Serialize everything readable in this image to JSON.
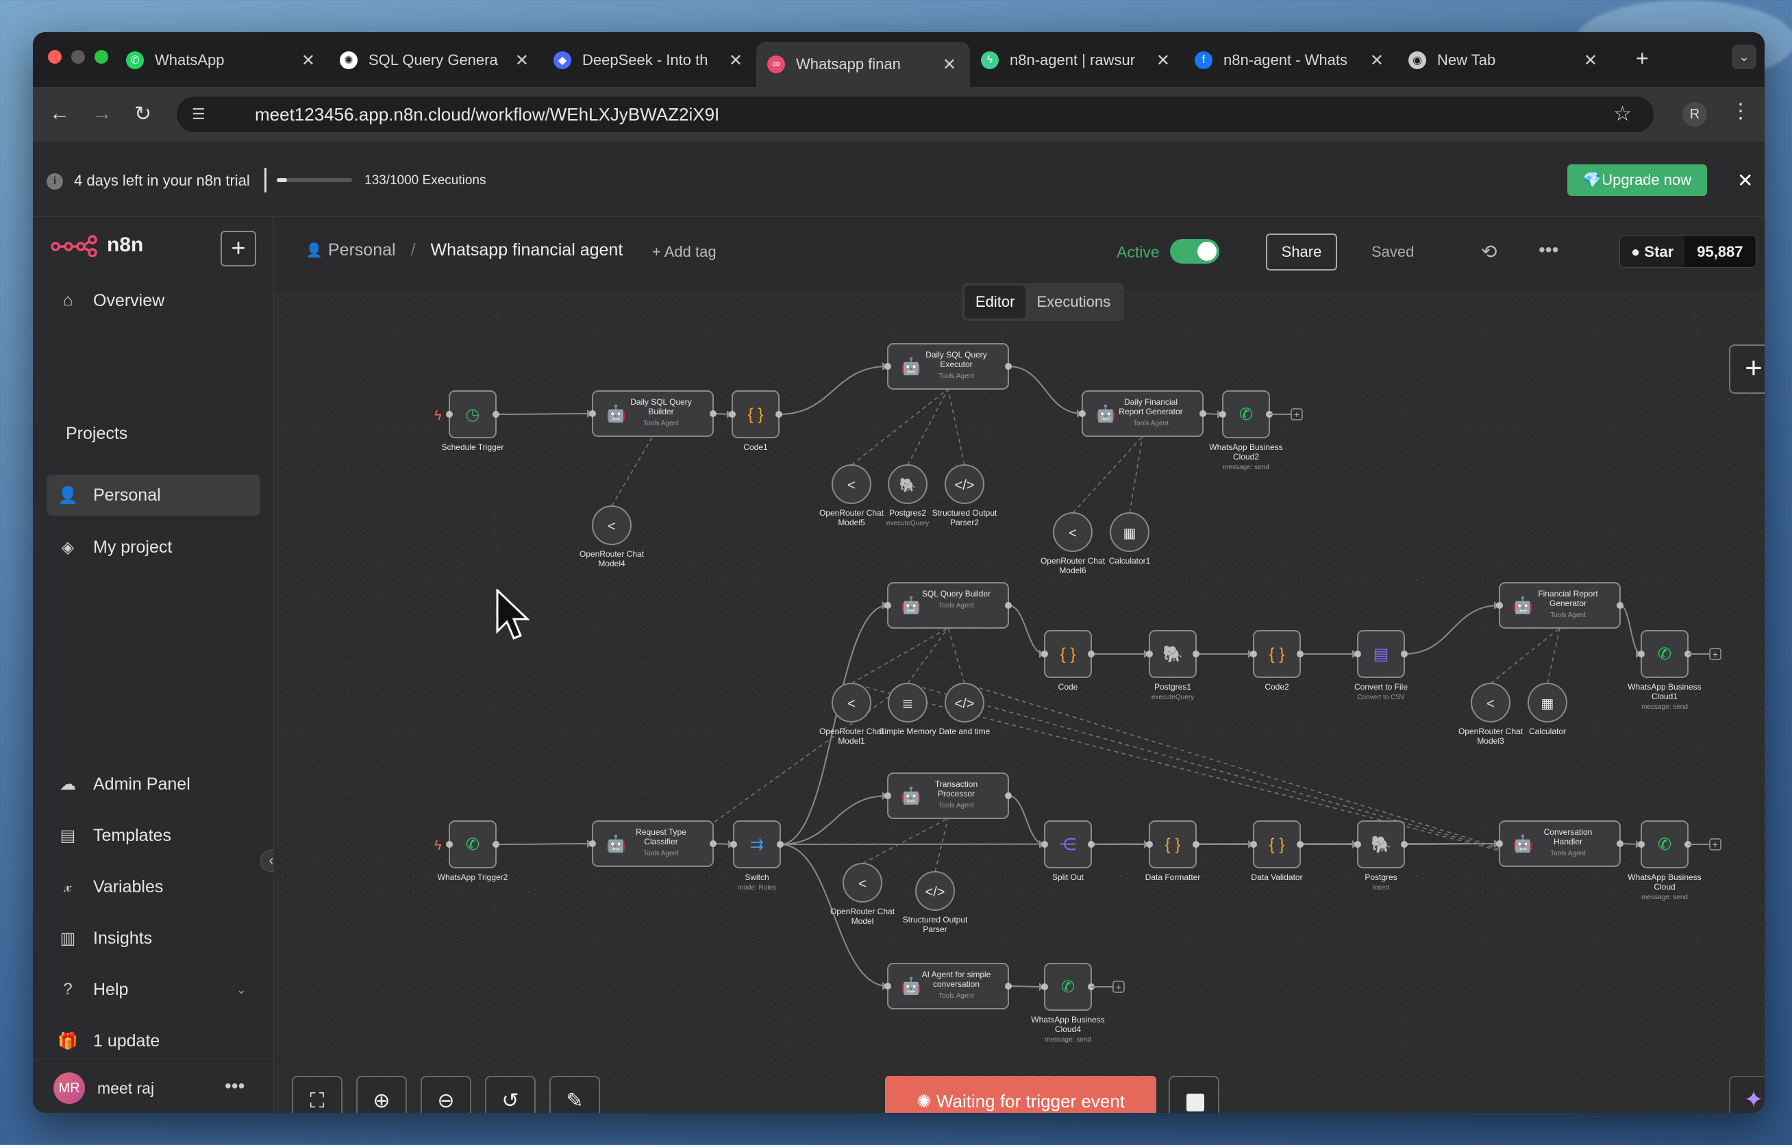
{
  "browser": {
    "tabs": [
      {
        "label": "WhatsApp",
        "icon": "whatsapp-icon",
        "color": "#25d366"
      },
      {
        "label": "SQL Query Genera",
        "icon": "openai-icon",
        "color": "#ffffff"
      },
      {
        "label": "DeepSeek - Into th",
        "icon": "deepseek-icon",
        "color": "#4d6bfe"
      },
      {
        "label": "Whatsapp finan",
        "icon": "n8n-icon",
        "color": "#ea4b71"
      },
      {
        "label": "n8n-agent | rawsur",
        "icon": "bolt-icon",
        "color": "#3fcf8e"
      },
      {
        "label": "n8n-agent - Whats",
        "icon": "facebook-icon",
        "color": "#1877f2"
      },
      {
        "label": "New Tab",
        "icon": "chrome-icon",
        "color": "#cccccc"
      }
    ],
    "url": "meet123456.app.n8n.cloud/workflow/WEhLXJyBWAZ2iX9I",
    "profile_initial": "R"
  },
  "trial": {
    "message": "4 days left in your n8n trial",
    "executions": "133/1000 Executions",
    "executions_used_fraction": 0.133,
    "upgrade_label": "Upgrade now"
  },
  "sidebar": {
    "brand": "n8n",
    "overview": "Overview",
    "projects_heading": "Projects",
    "projects": [
      "Personal",
      "My project"
    ],
    "bottom_items": [
      "Admin Panel",
      "Templates",
      "Variables",
      "Insights",
      "Help",
      "1 update"
    ],
    "user": {
      "initials": "MR",
      "name": "meet raj"
    }
  },
  "header": {
    "project": "Personal",
    "workflow_name": "Whatsapp financial agent",
    "add_tag": "+ Add tag",
    "active_label": "Active",
    "share_label": "Share",
    "saved_label": "Saved",
    "star_label": "Star",
    "star_count": "95,887"
  },
  "canvas": {
    "tabs": [
      "Editor",
      "Executions"
    ],
    "waiting_label": "Waiting for trigger event",
    "nodes": [
      {
        "id": "sched",
        "title": [
          "Schedule Trigger"
        ],
        "sub": "",
        "icon": "clock-icon"
      },
      {
        "id": "dsqlb",
        "title": [
          "Daily SQL Query",
          "Builder"
        ],
        "sub": "Tools Agent",
        "icon": "robot-icon"
      },
      {
        "id": "code1",
        "title": [
          "Code1"
        ],
        "sub": "",
        "icon": "code-braces-icon"
      },
      {
        "id": "dsqle",
        "title": [
          "Daily SQL Query",
          "Executor"
        ],
        "sub": "Tools Agent",
        "icon": "robot-icon"
      },
      {
        "id": "dfrg",
        "title": [
          "Daily Financial",
          "Report Generator"
        ],
        "sub": "Tools Agent",
        "icon": "robot-icon"
      },
      {
        "id": "wab2",
        "title": [
          "WhatsApp Business",
          "Cloud2"
        ],
        "sub": "message: send",
        "icon": "whatsapp-icon"
      },
      {
        "id": "orm4",
        "title": [
          "OpenRouter Chat",
          "Model4"
        ],
        "sub": "",
        "icon": "openrouter-icon"
      },
      {
        "id": "orm5",
        "title": [
          "OpenRouter Chat",
          "Model5"
        ],
        "sub": "",
        "icon": "openrouter-icon"
      },
      {
        "id": "pg2",
        "title": [
          "Postgres2"
        ],
        "sub": "executeQuery",
        "icon": "postgres-icon"
      },
      {
        "id": "sop2",
        "title": [
          "Structured Output",
          "Parser2"
        ],
        "sub": "",
        "icon": "code-tag-icon"
      },
      {
        "id": "orm6",
        "title": [
          "OpenRouter Chat",
          "Model6"
        ],
        "sub": "",
        "icon": "openrouter-icon"
      },
      {
        "id": "calc1",
        "title": [
          "Calculator1"
        ],
        "sub": "",
        "icon": "calculator-icon"
      },
      {
        "id": "sqlb",
        "title": [
          "SQL Query Builder"
        ],
        "sub": "Tools Agent",
        "icon": "robot-icon"
      },
      {
        "id": "code",
        "title": [
          "Code"
        ],
        "sub": "",
        "icon": "code-braces-icon"
      },
      {
        "id": "pg1",
        "title": [
          "Postgres1"
        ],
        "sub": "executeQuery",
        "icon": "postgres-icon"
      },
      {
        "id": "code2",
        "title": [
          "Code2"
        ],
        "sub": "",
        "icon": "code-braces-icon"
      },
      {
        "id": "ctf",
        "title": [
          "Convert to File"
        ],
        "sub": "Convert to CSV",
        "icon": "file-icon"
      },
      {
        "id": "frg",
        "title": [
          "Financial Report",
          "Generator"
        ],
        "sub": "Tools Agent",
        "icon": "robot-icon"
      },
      {
        "id": "wab1",
        "title": [
          "WhatsApp Business",
          "Cloud1"
        ],
        "sub": "message: send",
        "icon": "whatsapp-icon"
      },
      {
        "id": "orm1",
        "title": [
          "OpenRouter Chat",
          "Model1"
        ],
        "sub": "",
        "icon": "openrouter-icon"
      },
      {
        "id": "simem",
        "title": [
          "Simple Memory"
        ],
        "sub": "",
        "icon": "database-icon"
      },
      {
        "id": "dt",
        "title": [
          "Date and time"
        ],
        "sub": "",
        "icon": "code-tag-icon"
      },
      {
        "id": "orm3",
        "title": [
          "OpenRouter Chat",
          "Model3"
        ],
        "sub": "",
        "icon": "openrouter-icon"
      },
      {
        "id": "calc",
        "title": [
          "Calculator"
        ],
        "sub": "",
        "icon": "calculator-icon"
      },
      {
        "id": "wat2",
        "title": [
          "WhatsApp Trigger2"
        ],
        "sub": "",
        "icon": "whatsapp-icon"
      },
      {
        "id": "rtc",
        "title": [
          "Request Type",
          "Classifier"
        ],
        "sub": "Tools Agent",
        "icon": "robot-icon"
      },
      {
        "id": "switch",
        "title": [
          "Switch"
        ],
        "sub": "mode: Rules",
        "icon": "switch-icon"
      },
      {
        "id": "tp",
        "title": [
          "Transaction",
          "Processor"
        ],
        "sub": "Tools Agent",
        "icon": "robot-icon"
      },
      {
        "id": "split",
        "title": [
          "Split Out"
        ],
        "sub": "",
        "icon": "split-icon"
      },
      {
        "id": "df",
        "title": [
          "Data Formatter"
        ],
        "sub": "",
        "icon": "code-braces-icon"
      },
      {
        "id": "dv",
        "title": [
          "Data Validator"
        ],
        "sub": "",
        "icon": "code-braces-icon"
      },
      {
        "id": "pg",
        "title": [
          "Postgres"
        ],
        "sub": "insert",
        "icon": "postgres-icon"
      },
      {
        "id": "ch",
        "title": [
          "Conversation",
          "Handler"
        ],
        "sub": "Tools Agent",
        "icon": "robot-icon"
      },
      {
        "id": "wab",
        "title": [
          "WhatsApp Business",
          "Cloud"
        ],
        "sub": "message: send",
        "icon": "whatsapp-icon"
      },
      {
        "id": "orm",
        "title": [
          "OpenRouter Chat",
          "Model"
        ],
        "sub": "",
        "icon": "openrouter-icon"
      },
      {
        "id": "sop",
        "title": [
          "Structured Output",
          "Parser"
        ],
        "sub": "",
        "icon": "code-tag-icon"
      },
      {
        "id": "aisc",
        "title": [
          "AI Agent for simple",
          "conversation"
        ],
        "sub": "Tools Agent",
        "icon": "robot-icon"
      },
      {
        "id": "wab4",
        "title": [
          "WhatsApp Business",
          "Cloud4"
        ],
        "sub": "message: send",
        "icon": "whatsapp-icon"
      }
    ]
  }
}
